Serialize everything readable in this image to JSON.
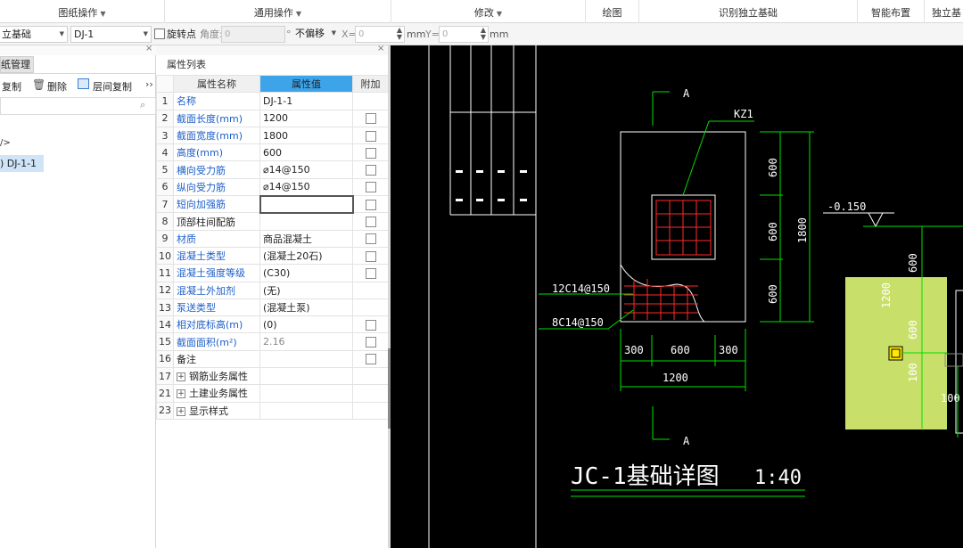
{
  "menu_groups": [
    {
      "label": "图纸操作",
      "arrow": true
    },
    {
      "label": "通用操作",
      "arrow": true
    },
    {
      "label": "修改",
      "arrow": true
    },
    {
      "label": "绘图",
      "arrow": false
    },
    {
      "label": "识别独立基础",
      "arrow": false
    },
    {
      "label": "智能布置",
      "arrow": false
    },
    {
      "label": "独立基",
      "arrow": false
    }
  ],
  "toolbar": {
    "element_type": "立基础",
    "element_name": "DJ-1",
    "rotate_label": "旋转点",
    "angle_label": "角度:",
    "angle_value": "0",
    "degree": "°",
    "offset_mode": "不偏移",
    "x_label": "X=",
    "x_value": "0",
    "mm1": "mm",
    "y_label": "Y=",
    "y_value": "0",
    "mm2": "mm"
  },
  "left_panel": {
    "tab": "纸管理",
    "copy": "复制",
    "delete": "删除",
    "floor_copy": "层间复制",
    "more": "››",
    "tree_parent": "/>",
    "tree_item": ") DJ-1-1"
  },
  "props": {
    "title": "属性列表",
    "col_name": "属性名称",
    "col_value": "属性值",
    "col_add": "附加",
    "rows": [
      {
        "n": "1",
        "name": "名称",
        "value": "DJ-1-1",
        "check": false
      },
      {
        "n": "2",
        "name": "截面长度(mm)",
        "value": "1200",
        "check": true
      },
      {
        "n": "3",
        "name": "截面宽度(mm)",
        "value": "1800",
        "check": true
      },
      {
        "n": "4",
        "name": "高度(mm)",
        "value": "600",
        "check": true
      },
      {
        "n": "5",
        "name": "横向受力筋",
        "value": "⌀14@150",
        "check": true
      },
      {
        "n": "6",
        "name": "纵向受力筋",
        "value": "⌀14@150",
        "check": true
      },
      {
        "n": "7",
        "name": "短向加强筋",
        "value": "",
        "check": true
      },
      {
        "n": "8",
        "name": "顶部柱间配筋",
        "value": "",
        "check": true
      },
      {
        "n": "9",
        "name": "材质",
        "value": "商品混凝土",
        "check": true
      },
      {
        "n": "10",
        "name": "混凝土类型",
        "value": "(混凝土20石)",
        "check": true
      },
      {
        "n": "11",
        "name": "混凝土强度等级",
        "value": "(C30)",
        "check": true
      },
      {
        "n": "12",
        "name": "混凝土外加剂",
        "value": "(无)",
        "check": false
      },
      {
        "n": "13",
        "name": "泵送类型",
        "value": "(混凝土泵)",
        "check": false
      },
      {
        "n": "14",
        "name": "相对底标高(m)",
        "value": "(0)",
        "check": true
      },
      {
        "n": "15",
        "name": "截面面积(m²)",
        "value": "2.16",
        "check": true
      },
      {
        "n": "16",
        "name": "备注",
        "value": "",
        "check": true
      },
      {
        "n": "17",
        "name": "钢筋业务属性",
        "value": "",
        "check": false
      },
      {
        "n": "21",
        "name": "土建业务属性",
        "value": "",
        "check": false
      },
      {
        "n": "23",
        "name": "显示样式",
        "value": "",
        "check": false
      }
    ]
  },
  "drawing": {
    "section_a": "A",
    "kz1": "KZ1",
    "dim_600a": "600",
    "dim_600b": "600",
    "dim_600c": "600",
    "dim_1800": "1800",
    "rebar1": "12C14@150",
    "rebar2": "8C14@150",
    "dim_300a": "300",
    "dim_600d": "600",
    "dim_300b": "300",
    "dim_1200": "1200",
    "elevation": "-0.150",
    "r600": "600",
    "r1200": "1200",
    "r600b": "600",
    "r100": "100",
    "r100b": "100",
    "title": "JC-1基础详图",
    "scale": "1:40",
    "colors": {
      "bg": "#000000",
      "line": "#ffffff",
      "rebar": "#ff2a2a",
      "dim": "#00e000",
      "highlight": "#c8e06a",
      "marker": "#ffea00"
    }
  }
}
